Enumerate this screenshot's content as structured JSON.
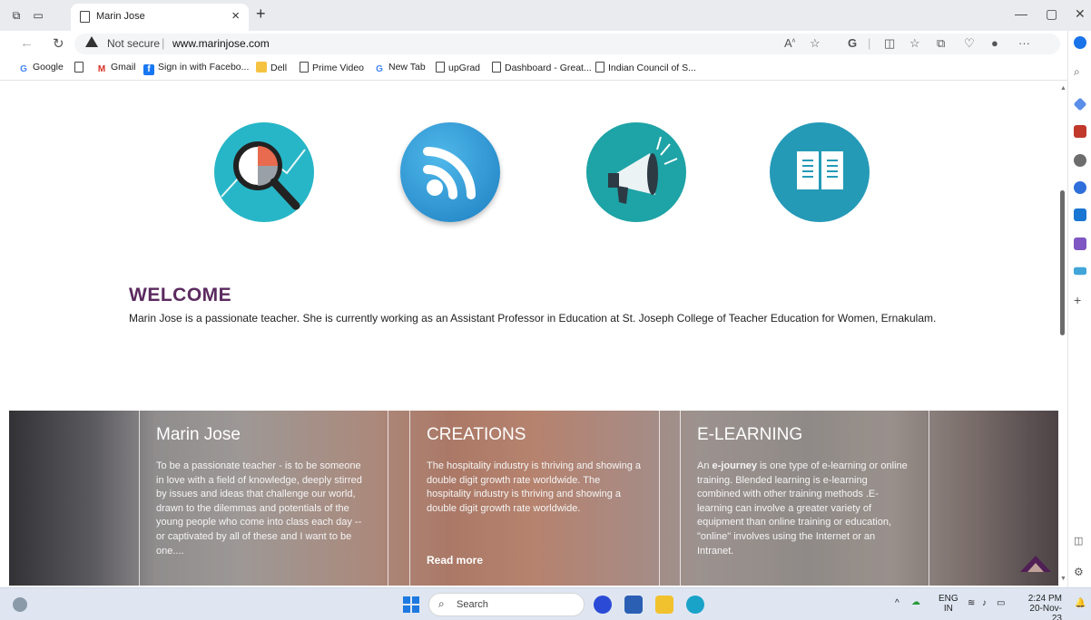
{
  "browser": {
    "tab_title": "Marin Jose",
    "security_label": "Not secure",
    "url": "www.marinjose.com",
    "bookmarks": [
      {
        "label": "Google",
        "icon": "google-icon"
      },
      {
        "label": "",
        "icon": "page-icon"
      },
      {
        "label": "Gmail",
        "icon": "gmail-icon"
      },
      {
        "label": "Sign in with Facebo...",
        "icon": "facebook-icon"
      },
      {
        "label": "Dell",
        "icon": "folder-icon"
      },
      {
        "label": "Prime Video",
        "icon": "page-icon"
      },
      {
        "label": "New Tab",
        "icon": "google-icon"
      },
      {
        "label": "upGrad",
        "icon": "page-icon"
      },
      {
        "label": "Dashboard - Great...",
        "icon": "page-icon"
      },
      {
        "label": "Indian Council of S...",
        "icon": "page-icon"
      }
    ]
  },
  "page": {
    "features": [
      {
        "icon": "analytics-magnifier-icon"
      },
      {
        "icon": "rss-feed-icon"
      },
      {
        "icon": "megaphone-icon"
      },
      {
        "icon": "open-book-icon"
      }
    ],
    "welcome_title": "WELCOME",
    "welcome_text": "Marin Jose is a passionate teacher. She is currently working as an Assistant Professor in Education at St. Joseph College of Teacher Education for Women, Ernakulam.",
    "columns": [
      {
        "title": "Marin Jose",
        "text": "To be a passionate teacher - is to be someone in love with a field of knowledge, deeply stirred by issues and ideas that challenge our world, drawn to the dilemmas and potentials of the young people who come into class each day -- or captivated by all of these and I want to be one....",
        "link": ""
      },
      {
        "title": "CREATIONS",
        "text": "The hospitality industry is thriving and showing a double digit growth rate worldwide. The hospitality industry is thriving and showing a double digit growth rate worldwide.",
        "link": "Read more"
      },
      {
        "title": "E-LEARNING",
        "text_bold": "e-journey",
        "text_pre": "An ",
        "text_post": " is one type of e-learning or online training. Blended learning is e-learning combined with other training methods .E-learning can involve a greater variety of equipment than online training or education, \"online\" involves using the Internet or an Intranet.",
        "link": ""
      }
    ]
  },
  "taskbar": {
    "search_label": "Search",
    "lang_top": "ENG",
    "lang_bottom": "IN",
    "time": "2:24 PM",
    "date": "20-Nov-23"
  },
  "colors": {
    "welcome_heading": "#5b2a5f",
    "back_to_top": "#4f1f55"
  }
}
